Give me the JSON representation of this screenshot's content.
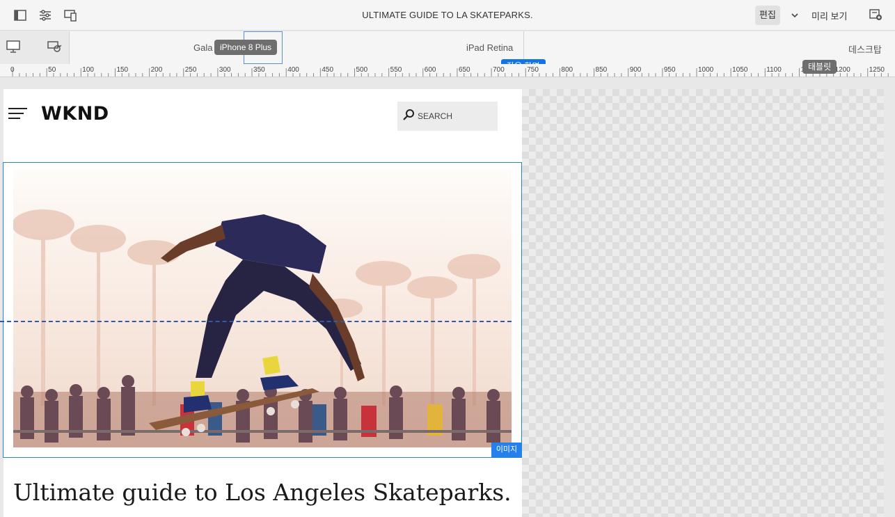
{
  "topbar": {
    "title": "ULTIMATE GUIDE TO LA SKATEPARKS.",
    "edit_label": "편집",
    "preview_label": "미리 보기",
    "icons": [
      "side-panel-icon",
      "page-properties-icon",
      "emulator-icon",
      "chevron-down-icon",
      "page-info-icon"
    ]
  },
  "emulator": {
    "devices": {
      "galaxy": "Gala",
      "iphone": "iPhone 8 Plus",
      "ipad": "iPad Retina",
      "desktop": "데스크탑"
    },
    "breakpoints": {
      "small": "작은 화면",
      "tablet": "태블릿"
    },
    "icons": [
      "desktop-icon",
      "rotate-device-icon"
    ]
  },
  "ruler": {
    "labels": [
      "0",
      "50",
      "100",
      "150",
      "200",
      "250",
      "300",
      "350",
      "400",
      "450",
      "500",
      "550",
      "600",
      "650",
      "700",
      "750",
      "800",
      "850",
      "900",
      "950",
      "1000",
      "1050",
      "1100",
      "1150",
      "1200",
      "1250"
    ]
  },
  "page": {
    "logo": "WKND",
    "search_placeholder": "SEARCH",
    "image_badge": "이미지",
    "headline": "Ultimate guide to Los Angeles Skateparks."
  },
  "colors": {
    "accent": "#2680eb",
    "selection_blue": "#1473e6",
    "tooltip_gray": "#6e6e6e"
  }
}
